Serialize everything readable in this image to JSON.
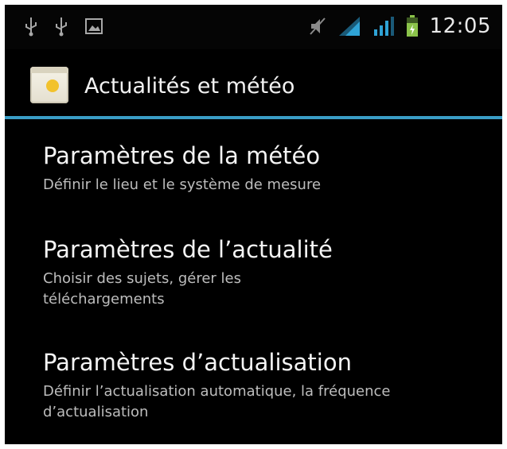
{
  "status_bar": {
    "time": "12:05",
    "left_icons": [
      "usb-icon",
      "usb-icon",
      "image-notification-icon"
    ],
    "right_icons": [
      "mute-icon",
      "wifi-signal-icon",
      "cell-signal-icon",
      "battery-icon"
    ],
    "colors": {
      "signal": "#2fa3d6",
      "battery": "#8bc34a"
    }
  },
  "action_bar": {
    "title": "Actualités et météo",
    "icon": "news-weather-app-icon",
    "divider_color": "#3a9dc6"
  },
  "preferences": [
    {
      "title": "Paramètres de la météo",
      "summary": "Définir le lieu et le système de mesure"
    },
    {
      "title": "Paramètres de l’actualité",
      "summary": "Choisir des sujets, gérer les téléchargements"
    },
    {
      "title": "Paramètres d’actualisation",
      "summary": "Définir l’actualisation automatique, la fréquence d’actualisation"
    }
  ]
}
